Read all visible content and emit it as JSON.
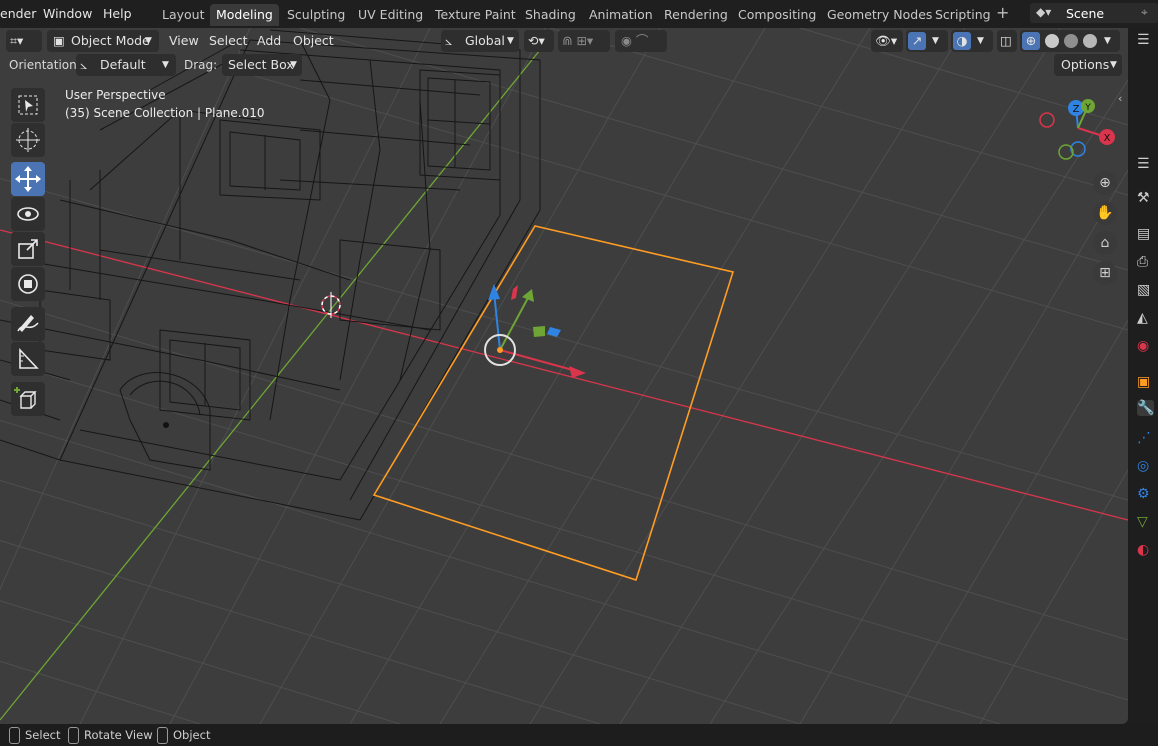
{
  "menus": [
    "ender",
    "Window",
    "Help"
  ],
  "workspaces": [
    "Layout",
    "Modeling",
    "Sculpting",
    "UV Editing",
    "Texture Paint",
    "Shading",
    "Animation",
    "Rendering",
    "Compositing",
    "Geometry Nodes",
    "Scripting"
  ],
  "active_workspace": "Modeling",
  "scene": {
    "name": "Scene"
  },
  "header": {
    "mode": "Object Mode",
    "view": "View",
    "select": "Select",
    "add": "Add",
    "object": "Object",
    "transform_orientation": "Global"
  },
  "tool_settings": {
    "orientation_label": "Orientation:",
    "orientation_value": "Default",
    "drag_label": "Drag:",
    "drag_value": "Select Box",
    "options": "Options"
  },
  "overlay_text": {
    "perspective": "User Perspective",
    "collection": "(35) Scene Collection | Plane.010"
  },
  "gizmo_axes": {
    "x": "X",
    "y": "Y",
    "z": "Z"
  },
  "tools": [
    "select-box",
    "cursor",
    "move",
    "rotate",
    "scale",
    "transform",
    "annotate",
    "measure",
    "add-cube"
  ],
  "active_tool": "move",
  "status_bar": {
    "select": "Select",
    "rotate": "Rotate View",
    "object": "Object"
  },
  "colors": {
    "accent": "#4b74b4",
    "selection_outline": "#ff9c23",
    "axis_x": "#d9354c",
    "axis_y": "#6ea535",
    "axis_z": "#2f84e3",
    "viewport_bg": "#3d3d3d"
  }
}
